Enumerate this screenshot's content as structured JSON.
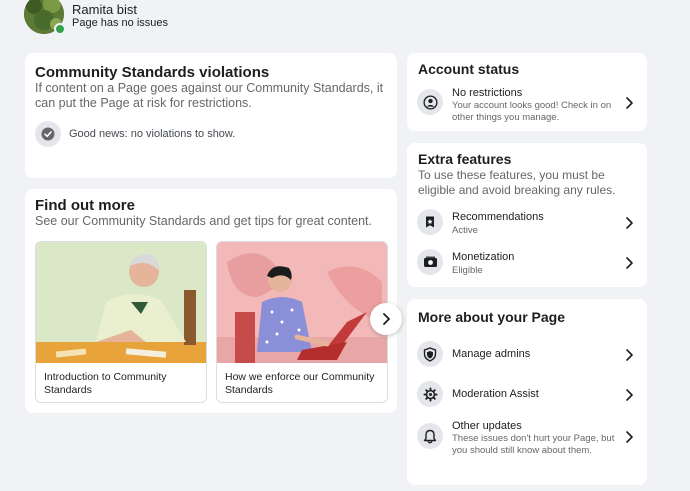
{
  "header": {
    "page_name": "Ramita bist",
    "page_status": "Page has no issues"
  },
  "violations": {
    "title": "Community Standards violations",
    "description": "If content on a Page goes against our Community Standards, it can put the Page at risk for restrictions.",
    "status_text": "Good news: no violations to show."
  },
  "find_out_more": {
    "title": "Find out more",
    "description": "See our Community Standards and get tips for great content.",
    "articles": [
      {
        "caption": "Introduction to Community Standards"
      },
      {
        "caption": "How we enforce our Community Standards"
      }
    ]
  },
  "account_status": {
    "title": "Account status",
    "item_title": "No restrictions",
    "item_sub": "Your account looks good! Check in on other things you manage."
  },
  "extra_features": {
    "title": "Extra features",
    "description": "To use these features, you must be eligible and avoid breaking any rules.",
    "items": [
      {
        "title": "Recommendations",
        "status": "Active"
      },
      {
        "title": "Monetization",
        "status": "Eligible"
      }
    ]
  },
  "more_about": {
    "title": "More about your Page",
    "items": [
      {
        "title": "Manage admins",
        "sub": ""
      },
      {
        "title": "Moderation Assist",
        "sub": ""
      },
      {
        "title": "Other updates",
        "sub": "These issues don't hurt your Page, but you should still know about them."
      }
    ]
  },
  "colors": {
    "background": "#f0f2f5",
    "card": "#ffffff",
    "icon_bg": "#e4e6eb",
    "online_green": "#31a24c",
    "muted_text": "#65676b"
  }
}
